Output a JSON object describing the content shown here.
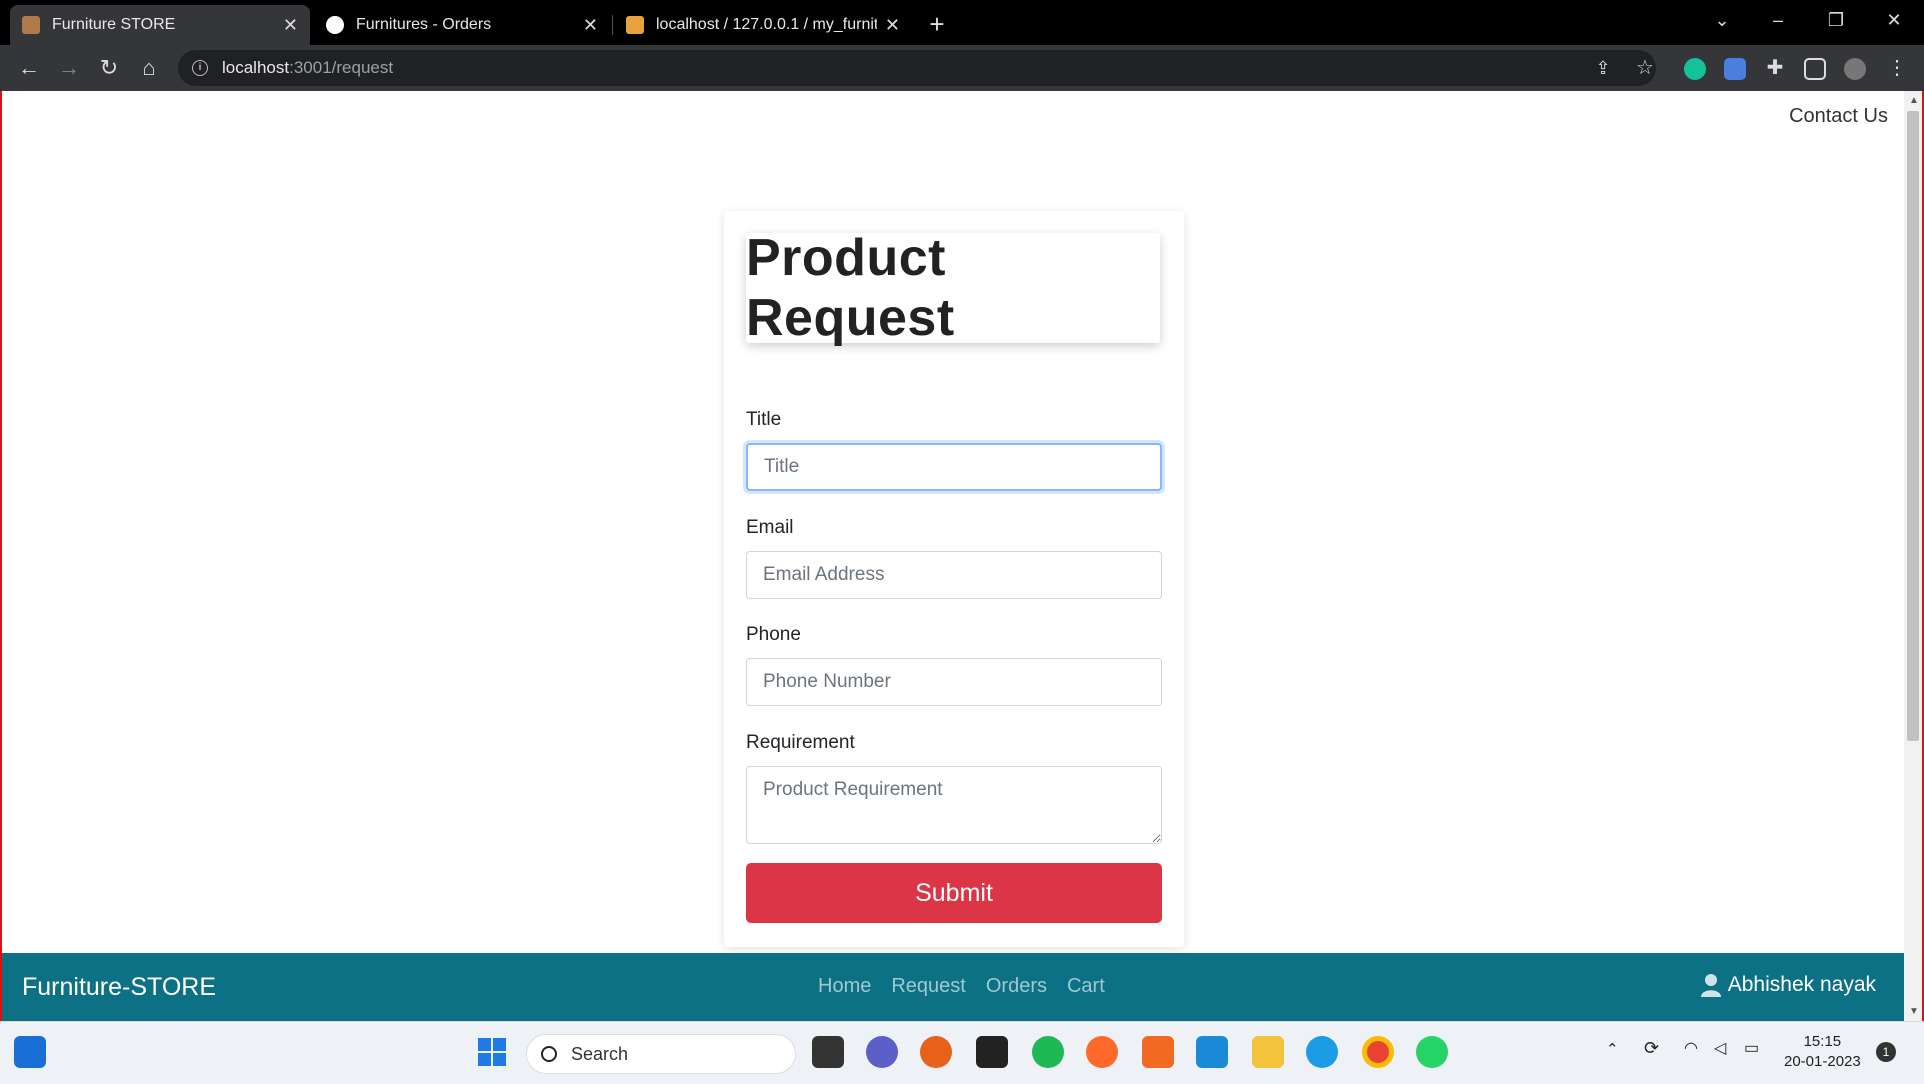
{
  "browser": {
    "tabs": [
      {
        "title": "Furniture STORE",
        "active": true
      },
      {
        "title": "Furnitures - Orders",
        "active": false
      },
      {
        "title": "localhost / 127.0.0.1 / my_furnitu",
        "active": false
      }
    ],
    "address": {
      "host": "localhost",
      "path": ":3001/request"
    }
  },
  "page": {
    "contact_link": "Contact Us",
    "heading": "Product Request",
    "form": {
      "title_label": "Title",
      "title_placeholder": "Title",
      "email_label": "Email",
      "email_placeholder": "Email Address",
      "phone_label": "Phone",
      "phone_placeholder": "Phone Number",
      "requirement_label": "Requirement",
      "requirement_placeholder": "Product Requirement",
      "submit_label": "Submit"
    },
    "navbar": {
      "brand": "Furniture-STORE",
      "links": [
        "Home",
        "Request",
        "Orders",
        "Cart"
      ],
      "user": "Abhishek nayak"
    }
  },
  "taskbar": {
    "search_placeholder": "Search",
    "time": "15:15",
    "date": "20-01-2023",
    "notification_count": "1"
  },
  "colors": {
    "submit": "#dc3545",
    "navbar": "#0c7185",
    "focus_ring": "#86b7fe"
  }
}
